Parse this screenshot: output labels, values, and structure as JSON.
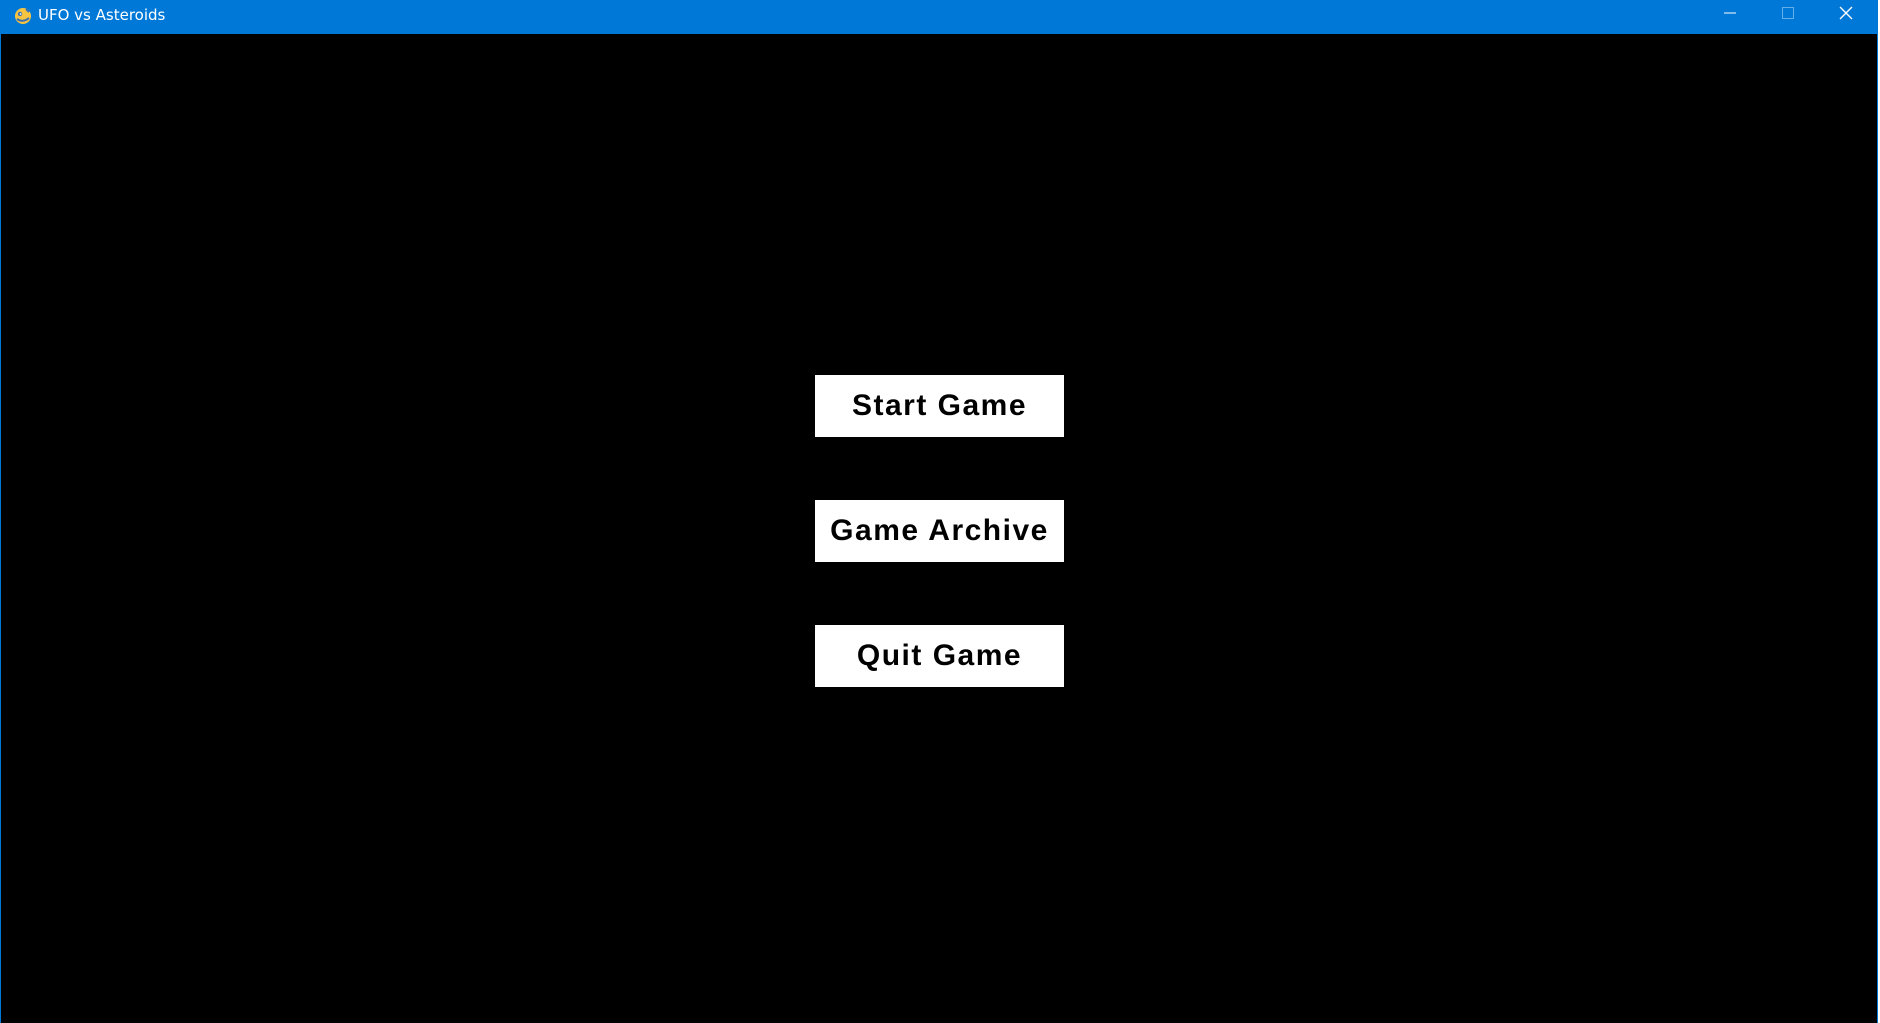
{
  "window": {
    "title": "UFO vs Asteroids",
    "app_icon": "pygame-snake-icon",
    "controls": {
      "minimize_icon": "minimize-icon",
      "maximize_icon": "maximize-icon",
      "close_icon": "close-icon"
    },
    "colors": {
      "titlebar": "#0078d7",
      "background": "#000000",
      "button_bg": "#ffffff",
      "button_text": "#000000"
    }
  },
  "menu": {
    "start_label": "Start Game",
    "archive_label": "Game Archive",
    "quit_label": "Quit Game"
  }
}
